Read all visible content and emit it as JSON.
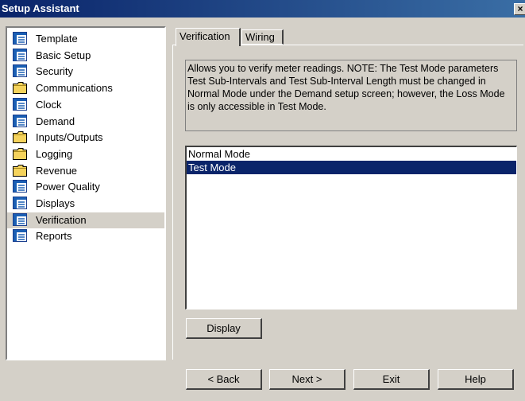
{
  "window": {
    "title": "Setup Assistant",
    "close": "×"
  },
  "sidebar": {
    "items": [
      {
        "label": "Template",
        "icon": "document-icon"
      },
      {
        "label": "Basic Setup",
        "icon": "document-icon"
      },
      {
        "label": "Security",
        "icon": "document-icon"
      },
      {
        "label": "Communications",
        "icon": "folder-icon"
      },
      {
        "label": "Clock",
        "icon": "document-icon"
      },
      {
        "label": "Demand",
        "icon": "document-icon"
      },
      {
        "label": "Inputs/Outputs",
        "icon": "folder-icon"
      },
      {
        "label": "Logging",
        "icon": "folder-icon"
      },
      {
        "label": "Revenue",
        "icon": "folder-icon"
      },
      {
        "label": "Power Quality",
        "icon": "document-icon"
      },
      {
        "label": "Displays",
        "icon": "document-icon"
      },
      {
        "label": "Verification",
        "icon": "document-icon",
        "selected": true
      },
      {
        "label": "Reports",
        "icon": "document-icon"
      }
    ]
  },
  "tabs": [
    {
      "label": "Verification",
      "active": true
    },
    {
      "label": "Wiring",
      "active": false
    }
  ],
  "description": "Allows you to verify meter readings. NOTE: The Test Mode parameters Test Sub-Intervals and Test Sub-Interval Length must be changed in Normal Mode under the Demand setup screen; however, the Loss Mode is only accessible in Test Mode.",
  "modes": {
    "options": [
      "Normal Mode",
      "Test Mode"
    ],
    "selected": "Test Mode"
  },
  "buttons": {
    "display": "Display",
    "back": "< Back",
    "next": "Next >",
    "exit": "Exit",
    "help": "Help"
  },
  "colors": {
    "titlebar": "#0a246a",
    "selection": "#0a246a",
    "face": "#d4d0c8",
    "folder": "#f5d35c"
  }
}
